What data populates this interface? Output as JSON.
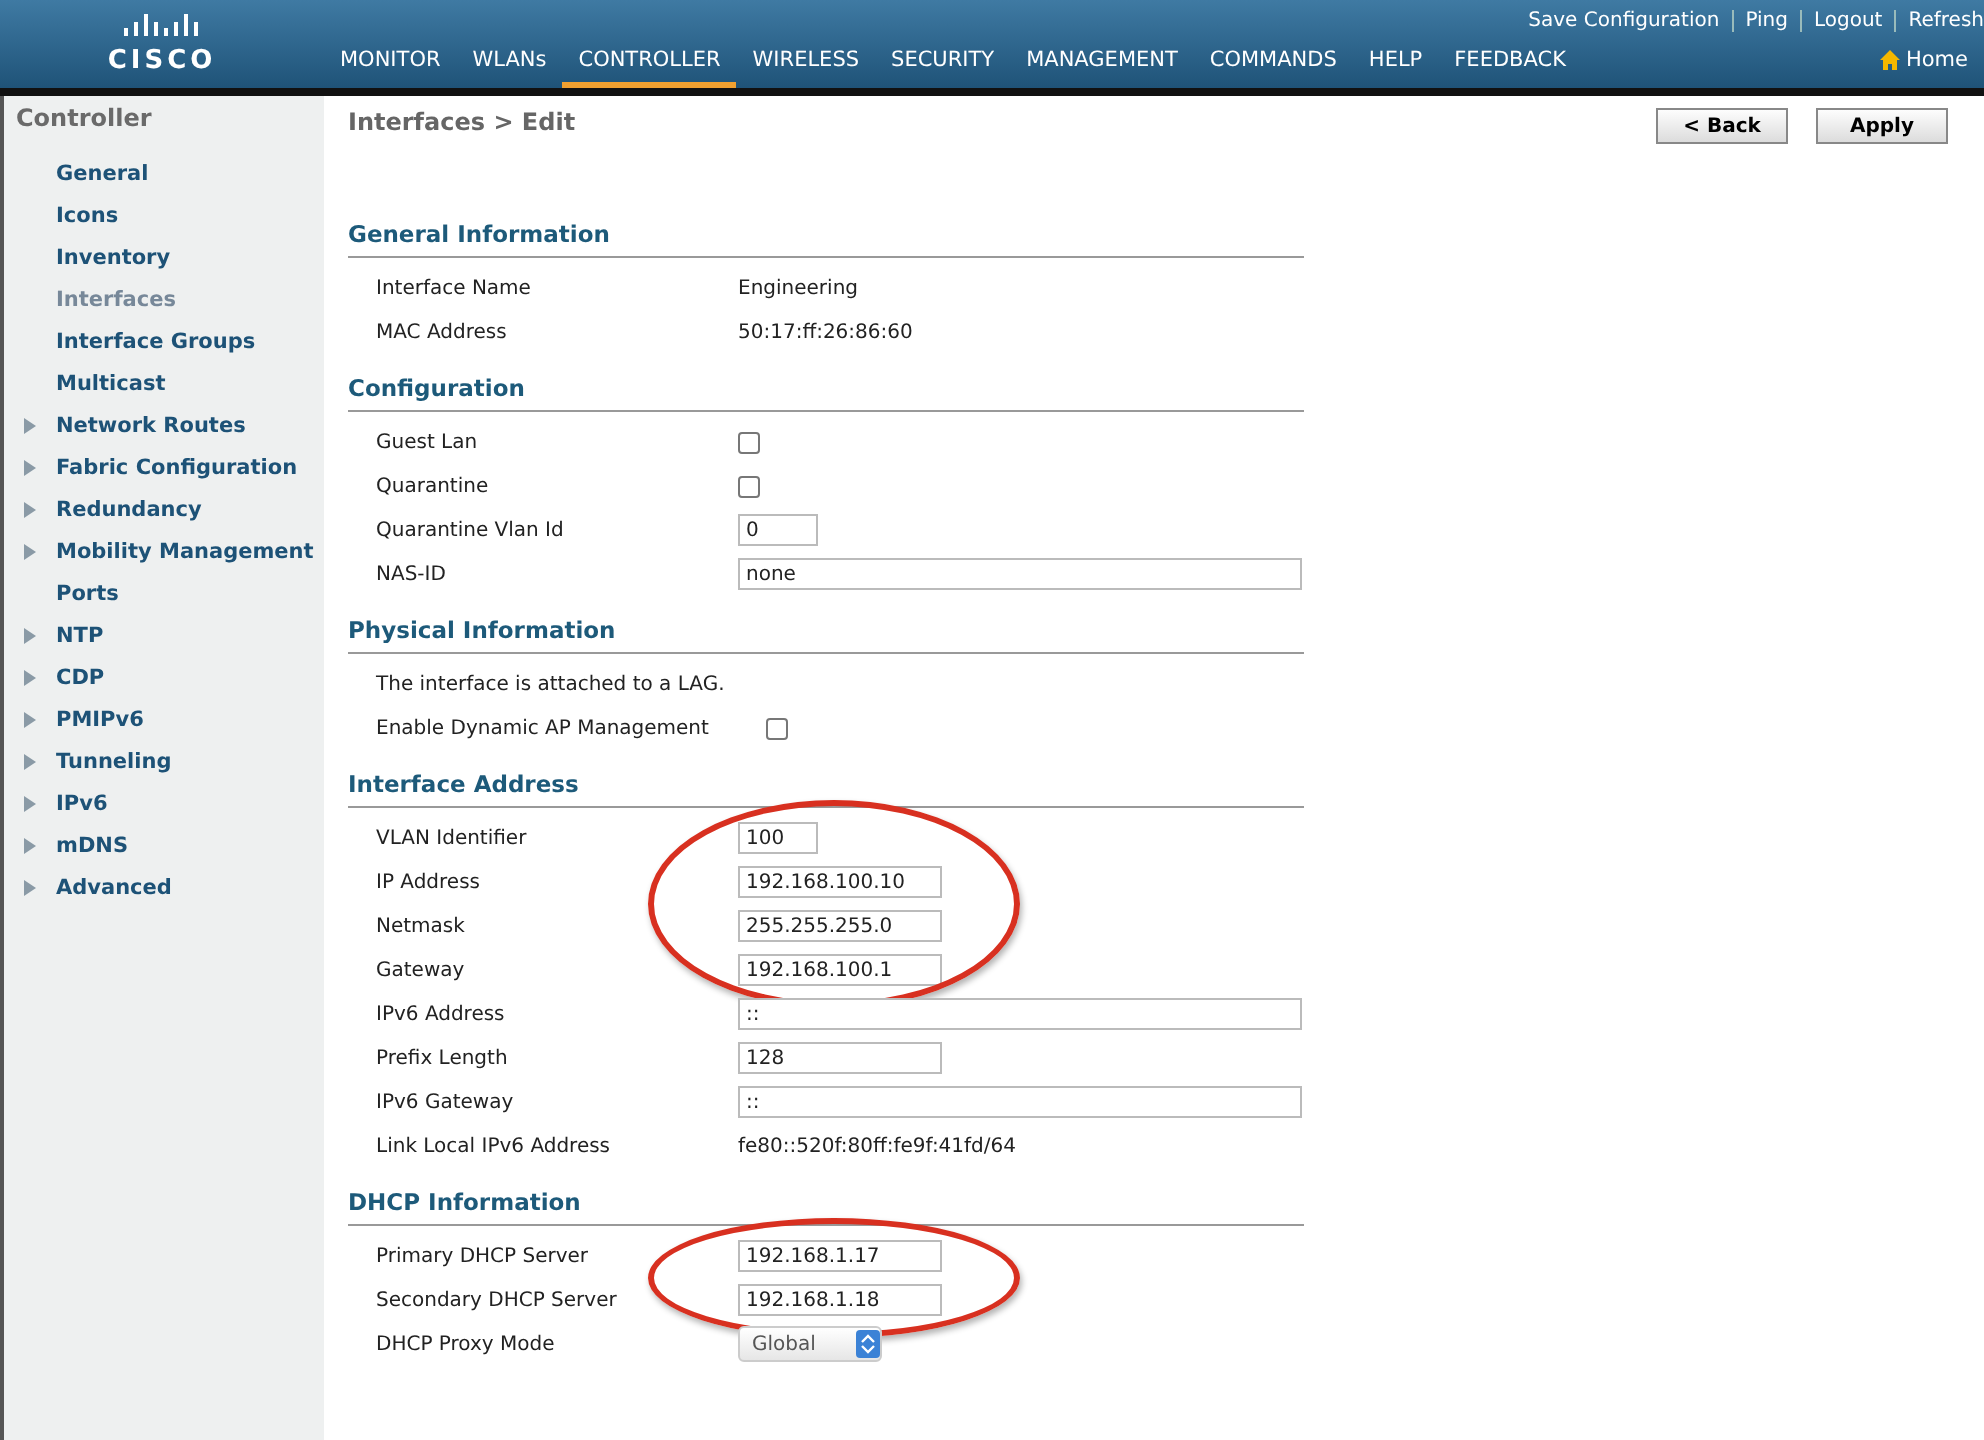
{
  "header": {
    "logo": "CISCO",
    "top_links": [
      "Save Configuration",
      "Ping",
      "Logout",
      "Refresh"
    ],
    "nav": [
      {
        "label": "MONITOR",
        "selected": false
      },
      {
        "label": "WLANs",
        "selected": false
      },
      {
        "label": "CONTROLLER",
        "selected": true
      },
      {
        "label": "WIRELESS",
        "selected": false
      },
      {
        "label": "SECURITY",
        "selected": false
      },
      {
        "label": "MANAGEMENT",
        "selected": false
      },
      {
        "label": "COMMANDS",
        "selected": false
      },
      {
        "label": "HELP",
        "selected": false
      },
      {
        "label": "FEEDBACK",
        "selected": false
      }
    ],
    "home": "Home"
  },
  "sidebar": {
    "title": "Controller",
    "items": [
      {
        "label": "General",
        "expandable": false,
        "selected": false
      },
      {
        "label": "Icons",
        "expandable": false,
        "selected": false
      },
      {
        "label": "Inventory",
        "expandable": false,
        "selected": false
      },
      {
        "label": "Interfaces",
        "expandable": false,
        "selected": true
      },
      {
        "label": "Interface Groups",
        "expandable": false,
        "selected": false
      },
      {
        "label": "Multicast",
        "expandable": false,
        "selected": false
      },
      {
        "label": "Network Routes",
        "expandable": true,
        "selected": false
      },
      {
        "label": "Fabric Configuration",
        "expandable": true,
        "selected": false
      },
      {
        "label": "Redundancy",
        "expandable": true,
        "selected": false
      },
      {
        "label": "Mobility Management",
        "expandable": true,
        "selected": false
      },
      {
        "label": "Ports",
        "expandable": false,
        "selected": false
      },
      {
        "label": "NTP",
        "expandable": true,
        "selected": false
      },
      {
        "label": "CDP",
        "expandable": true,
        "selected": false
      },
      {
        "label": "PMIPv6",
        "expandable": true,
        "selected": false
      },
      {
        "label": "Tunneling",
        "expandable": true,
        "selected": false
      },
      {
        "label": "IPv6",
        "expandable": true,
        "selected": false
      },
      {
        "label": "mDNS",
        "expandable": true,
        "selected": false
      },
      {
        "label": "Advanced",
        "expandable": true,
        "selected": false
      }
    ]
  },
  "content": {
    "title": "Interfaces > Edit",
    "buttons": [
      "< Back",
      "Apply"
    ],
    "sections": [
      {
        "title": "General Information",
        "rows": [
          {
            "kind": "text",
            "label": "Interface Name",
            "value": "Engineering",
            "circled": false
          },
          {
            "kind": "text",
            "label": "MAC Address",
            "value": "50:17:ff:26:86:60",
            "circled": false
          }
        ]
      },
      {
        "title": "Configuration",
        "rows": [
          {
            "kind": "checkbox",
            "label": "Guest Lan",
            "checked": false,
            "circled": false
          },
          {
            "kind": "checkbox",
            "label": "Quarantine",
            "checked": false,
            "circled": false
          },
          {
            "kind": "short-input",
            "label": "Quarantine Vlan Id",
            "value": "0",
            "circled": false
          },
          {
            "kind": "wide-input",
            "label": "NAS-ID",
            "value": "none",
            "circled": false
          }
        ]
      },
      {
        "title": "Physical Information",
        "rows": [
          {
            "kind": "note",
            "label": "The interface is attached to a LAG.",
            "circled": false
          },
          {
            "kind": "checkbox",
            "label": "Enable Dynamic AP Management",
            "checked": false,
            "circled": false
          }
        ]
      },
      {
        "title": "Interface Address",
        "rows": [
          {
            "kind": "short-input",
            "label": "VLAN Identifier",
            "value": "100",
            "circled": true
          },
          {
            "kind": "input",
            "label": "IP Address",
            "value": "192.168.100.10",
            "circled": true
          },
          {
            "kind": "input",
            "label": "Netmask",
            "value": "255.255.255.0",
            "circled": true
          },
          {
            "kind": "input",
            "label": "Gateway",
            "value": "192.168.100.1",
            "circled": true
          },
          {
            "kind": "wide-input",
            "label": "IPv6 Address",
            "value": "::",
            "circled": false
          },
          {
            "kind": "input",
            "label": "Prefix Length",
            "value": "128",
            "circled": false
          },
          {
            "kind": "wide-input",
            "label": "IPv6 Gateway",
            "value": "::",
            "circled": false
          },
          {
            "kind": "text",
            "label": "Link Local IPv6 Address",
            "value": "fe80::520f:80ff:fe9f:41fd/64",
            "circled": false
          }
        ]
      },
      {
        "title": "DHCP Information",
        "rows": [
          {
            "kind": "input",
            "label": "Primary DHCP Server",
            "value": "192.168.1.17",
            "circled": true
          },
          {
            "kind": "input",
            "label": "Secondary DHCP Server",
            "value": "192.168.1.18",
            "circled": true
          },
          {
            "kind": "select",
            "label": "DHCP Proxy Mode",
            "value": "Global",
            "circled": false
          }
        ]
      }
    ]
  }
}
